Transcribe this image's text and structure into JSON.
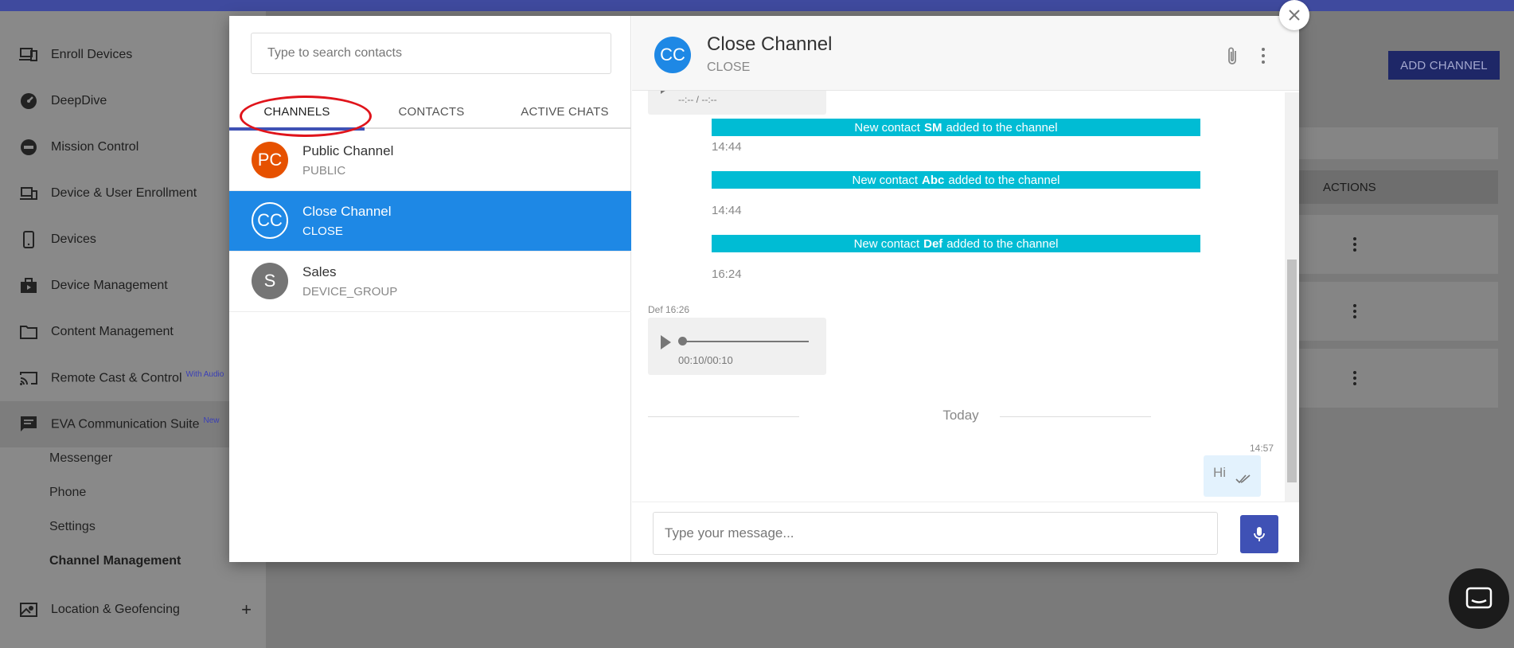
{
  "sidebar": {
    "items": [
      {
        "label": "Enroll Devices",
        "icon": "enroll-devices-icon"
      },
      {
        "label": "DeepDive",
        "icon": "gauge-icon"
      },
      {
        "label": "Mission Control",
        "icon": "mission-control-icon"
      },
      {
        "label": "Device & User Enrollment",
        "icon": "devices-icon"
      },
      {
        "label": "Devices",
        "icon": "phone-icon"
      },
      {
        "label": "Device Management",
        "icon": "briefcase-icon"
      },
      {
        "label": "Content Management",
        "icon": "folder-icon"
      },
      {
        "label": "Remote Cast & Control",
        "icon": "cast-icon",
        "badge": "With Audio"
      },
      {
        "label": "EVA Communication Suite",
        "icon": "chat-icon",
        "badge": "New"
      },
      {
        "label": "Location & Geofencing",
        "icon": "map-icon",
        "expand": "+"
      }
    ],
    "subitems": [
      "Messenger",
      "Phone",
      "Settings",
      "Channel Management"
    ]
  },
  "main": {
    "add_channel_label": "ADD CHANNEL",
    "actions_header": "ACTIONS"
  },
  "modal": {
    "search_placeholder": "Type to search contacts",
    "tabs": [
      "CHANNELS",
      "CONTACTS",
      "ACTIVE CHATS"
    ],
    "channels": [
      {
        "initials": "PC",
        "name": "Public Channel",
        "type": "PUBLIC",
        "color": "#e65100"
      },
      {
        "initials": "CC",
        "name": "Close Channel",
        "type": "CLOSE",
        "color": "#1e88e5"
      },
      {
        "initials": "S",
        "name": "Sales",
        "type": "DEVICE_GROUP",
        "color": "#757575"
      }
    ],
    "chat": {
      "initials": "CC",
      "title": "Close Channel",
      "status": "CLOSE",
      "top_audio_time": "--:-- / --:--",
      "system_messages": [
        {
          "prefix": "New contact",
          "name": "SM",
          "suffix": "added to the channel",
          "time": "14:44"
        },
        {
          "prefix": "New contact",
          "name": "Abc",
          "suffix": "added to the channel",
          "time": "14:44"
        },
        {
          "prefix": "New contact",
          "name": "Def",
          "suffix": "added to the channel",
          "time": "16:24"
        }
      ],
      "audio_sender": "Def 16:26",
      "audio_duration": "00:10/00:10",
      "day_divider": "Today",
      "my_message": {
        "time": "14:57",
        "text": "Hi"
      },
      "composer_placeholder": "Type your message..."
    }
  },
  "colors": {
    "accent": "#3f51b5",
    "selected_row": "#1e88e5",
    "system_bar": "#00bcd4",
    "highlight_oval": "#e0141b"
  }
}
